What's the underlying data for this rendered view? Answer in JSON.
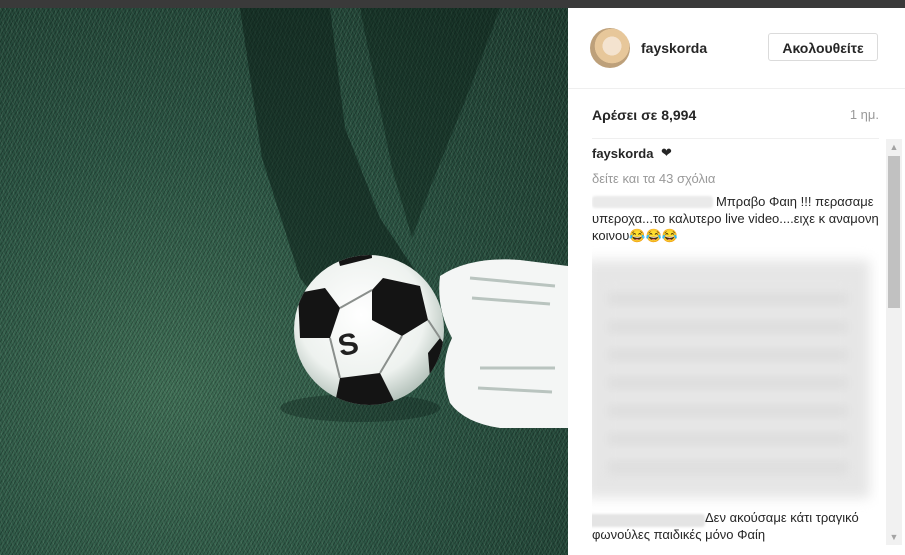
{
  "post": {
    "username": "fayskorda",
    "follow_label": "Ακολουθείτε",
    "likes_text": "Αρέσει σε 8,994",
    "time_ago": "1 ημ.",
    "caption_user": "fayskorda",
    "caption_emoji": "❤",
    "view_all_comments": "δείτε και τα 43 σχόλια",
    "comments": [
      {
        "text": "Μπραβο Φαιη !!! περασαμε υπεροχα...το καλυτερο live video....ειχε κ αναμονη κοινου😂😂😂"
      },
      {
        "text": "Δεν ακούσαμε κάτι τραγικό φωνούλες παιδικές μόνο Φαίη"
      }
    ]
  },
  "scrollbar": {
    "up_arrow": "▲",
    "down_arrow": "▼"
  },
  "colors": {
    "accent_text": "#262626",
    "muted": "#999999",
    "grass": "#2b5443"
  }
}
